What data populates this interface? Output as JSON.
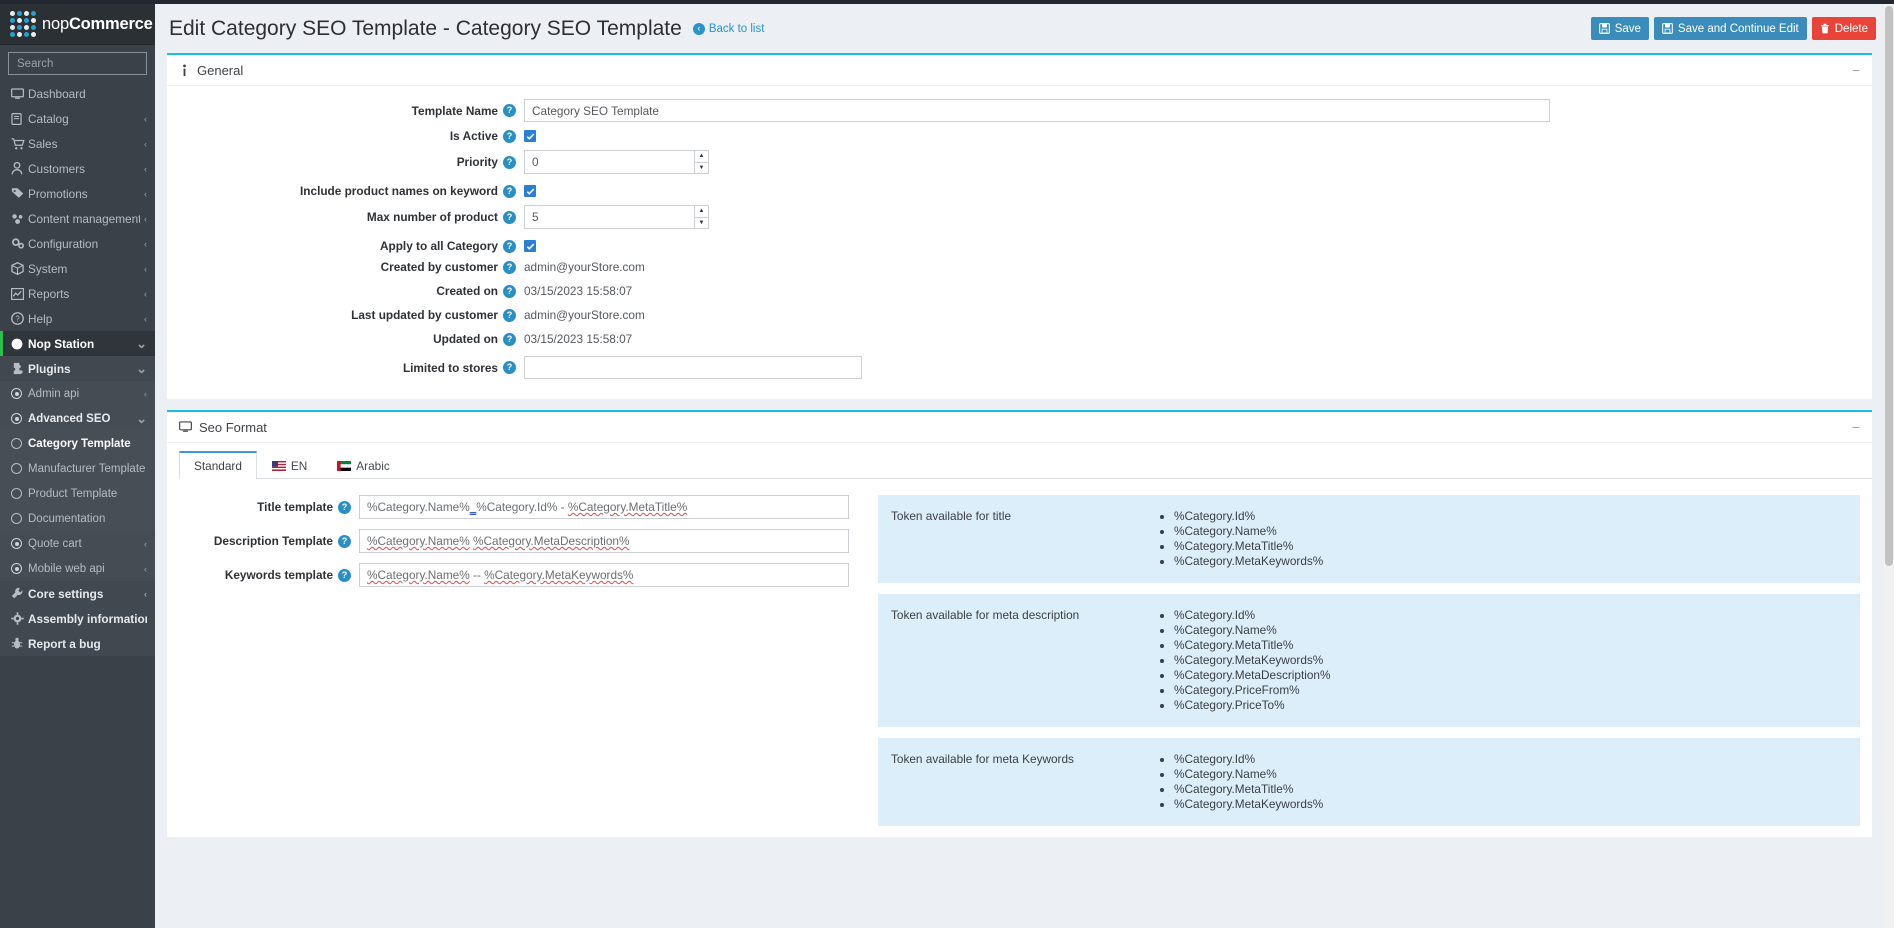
{
  "brand": {
    "name_light": "nop",
    "name_bold": "Commerce"
  },
  "search": {
    "placeholder": "Search",
    "value": ""
  },
  "sidebar": {
    "items": [
      {
        "label": "Dashboard",
        "icon": "monitor-icon",
        "level": 0,
        "caret": ""
      },
      {
        "label": "Catalog",
        "icon": "book-icon",
        "level": 0,
        "caret": "left"
      },
      {
        "label": "Sales",
        "icon": "cart-icon",
        "level": 0,
        "caret": "left"
      },
      {
        "label": "Customers",
        "icon": "user-icon",
        "level": 0,
        "caret": "left"
      },
      {
        "label": "Promotions",
        "icon": "tag-icon",
        "level": 0,
        "caret": "left"
      },
      {
        "label": "Content management",
        "icon": "content-icon",
        "level": 0,
        "caret": "left"
      },
      {
        "label": "Configuration",
        "icon": "gears-icon",
        "level": 0,
        "caret": "left"
      },
      {
        "label": "System",
        "icon": "box-icon",
        "level": 0,
        "caret": "left"
      },
      {
        "label": "Reports",
        "icon": "chart-icon",
        "level": 0,
        "caret": "left"
      },
      {
        "label": "Help",
        "icon": "question-circle-icon",
        "level": 0,
        "caret": "left"
      },
      {
        "label": "Nop Station",
        "icon": "circle-icon",
        "level": 0,
        "caret": "down"
      },
      {
        "label": "Plugins",
        "icon": "puzzle-icon",
        "level": 1,
        "caret": "down"
      },
      {
        "label": "Admin api",
        "icon": "radio-dot-icon",
        "level": 2,
        "caret": "left"
      },
      {
        "label": "Advanced SEO",
        "icon": "radio-dot-icon",
        "level": 2,
        "caret": "down"
      },
      {
        "label": "Category Template",
        "icon": "radio-empty-icon",
        "level": 3,
        "caret": ""
      },
      {
        "label": "Manufacturer Template",
        "icon": "radio-empty-icon",
        "level": 3,
        "caret": ""
      },
      {
        "label": "Product Template",
        "icon": "radio-empty-icon",
        "level": 3,
        "caret": ""
      },
      {
        "label": "Documentation",
        "icon": "radio-empty-icon",
        "level": 3,
        "caret": ""
      },
      {
        "label": "Quote cart",
        "icon": "radio-dot-icon",
        "level": 2,
        "caret": "left"
      },
      {
        "label": "Mobile web api",
        "icon": "radio-dot-icon",
        "level": 2,
        "caret": "left"
      },
      {
        "label": "Core settings",
        "icon": "wrench-icon",
        "level": 1,
        "caret": "left"
      },
      {
        "label": "Assembly information",
        "icon": "gear-icon",
        "level": 1,
        "caret": ""
      },
      {
        "label": "Report a bug",
        "icon": "bug-icon",
        "level": 1,
        "caret": ""
      }
    ]
  },
  "header": {
    "title": "Edit Category SEO Template - Category SEO Template",
    "back_to_list": "Back to list",
    "save_label": "Save",
    "save_continue_label": "Save and Continue Edit",
    "delete_label": "Delete"
  },
  "general": {
    "section_title": "General",
    "collapse_glyph": "−",
    "fields": {
      "template_name": {
        "label": "Template Name",
        "value": "Category SEO Template"
      },
      "is_active": {
        "label": "Is Active",
        "checked": true
      },
      "priority": {
        "label": "Priority",
        "value": "0"
      },
      "include_product_names": {
        "label": "Include product names on keyword",
        "checked": true
      },
      "max_number_of_product": {
        "label": "Max number of product",
        "value": "5"
      },
      "apply_to_all_category": {
        "label": "Apply to all Category",
        "checked": true
      },
      "created_by_customer": {
        "label": "Created by customer",
        "value": "admin@yourStore.com"
      },
      "created_on": {
        "label": "Created on",
        "value": "03/15/2023 15:58:07"
      },
      "last_updated_by_customer": {
        "label": "Last updated by customer",
        "value": "admin@yourStore.com"
      },
      "updated_on": {
        "label": "Updated on",
        "value": "03/15/2023 15:58:07"
      },
      "limited_to_stores": {
        "label": "Limited to stores",
        "value": ""
      }
    }
  },
  "seo": {
    "section_title": "Seo Format",
    "collapse_glyph": "−",
    "tabs": [
      {
        "label": "Standard",
        "flag": "",
        "active": true
      },
      {
        "label": "EN",
        "flag": "us-flag-icon",
        "active": false
      },
      {
        "label": "Arabic",
        "flag": "ae-flag-icon",
        "active": false
      }
    ],
    "fields": {
      "title_template": {
        "label": "Title template",
        "value": "%Category.Name%_%Category.Id% - %Category.MetaTitle%",
        "parts": [
          {
            "t": "%Category.Name%",
            "style": "plain"
          },
          {
            "t": "_",
            "style": "blue"
          },
          {
            "t": "%Category.Id%",
            "style": "plain"
          },
          {
            "t": " - ",
            "style": "plain"
          },
          {
            "t": "%Category.MetaTitle%",
            "style": "red"
          }
        ]
      },
      "description_template": {
        "label": "Description Template",
        "value": "%Category.Name% %Category.MetaDescription%",
        "parts": [
          {
            "t": "%Category.Name%",
            "style": "red"
          },
          {
            "t": " ",
            "style": "plain"
          },
          {
            "t": "%Category.MetaDescription%",
            "style": "red"
          }
        ]
      },
      "keywords_template": {
        "label": "Keywords template",
        "value": "%Category.Name% -- %Category.MetaKeywords%",
        "parts": [
          {
            "t": "%Category.Name%",
            "style": "red"
          },
          {
            "t": " -- ",
            "style": "plain"
          },
          {
            "t": "%Category.MetaKeywords%",
            "style": "red"
          }
        ]
      }
    },
    "token_panels": [
      {
        "label": "Token available for title",
        "tokens": [
          "%Category.Id%",
          "%Category.Name%",
          "%Category.MetaTitle%",
          "%Category.MetaKeywords%"
        ]
      },
      {
        "label": "Token available for meta description",
        "tokens": [
          "%Category.Id%",
          "%Category.Name%",
          "%Category.MetaTitle%",
          "%Category.MetaKeywords%",
          "%Category.MetaDescription%",
          "%Category.PriceFrom%",
          "%Category.PriceTo%"
        ]
      },
      {
        "label": "Token available for meta Keywords",
        "tokens": [
          "%Category.Id%",
          "%Category.Name%",
          "%Category.MetaTitle%",
          "%Category.MetaKeywords%"
        ]
      }
    ]
  },
  "colors": {
    "accent": "#18bee7",
    "primary_button": "#3a8dbb",
    "danger_button": "#e8443a",
    "sidebar_bg": "#3a4149",
    "token_panel_bg": "#ddeefb",
    "page_bg": "#eceff4"
  }
}
